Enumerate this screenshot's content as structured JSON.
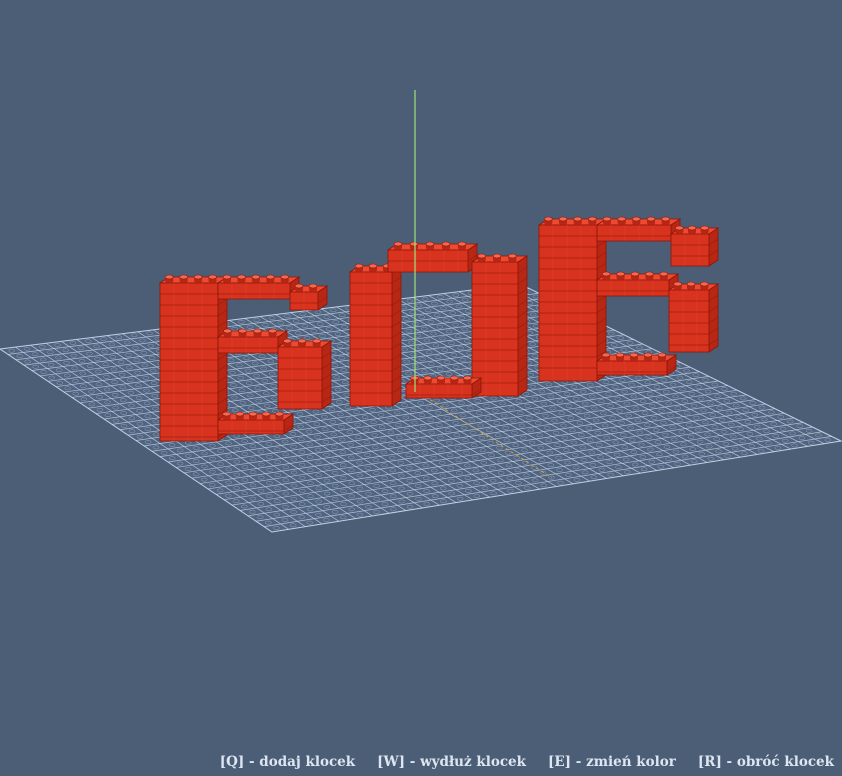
{
  "colors": {
    "background": "#4b5e76",
    "grid_line": "#c4d2e2",
    "brick_front": "#d8331f",
    "brick_side": "#b82614",
    "brick_top": "#ec4a33",
    "brick_edge": "#8e1608",
    "stud": "#e8422c",
    "stud_top": "#f36a52",
    "axis_vertical": "#9ee27a",
    "axis_depth": "#d9a040",
    "hud_text": "#dde6f2"
  },
  "hud": {
    "hints": [
      {
        "key": "[Q]",
        "label": "dodaj klocek"
      },
      {
        "key": "[W]",
        "label": "wydłuż klocek"
      },
      {
        "key": "[E]",
        "label": "zmień kolor"
      },
      {
        "key": "[R]",
        "label": "obróć klocek"
      }
    ],
    "hint_texts": [
      "[Q] - dodaj klocek",
      "[W] - wydłuż klocek",
      "[E] - zmień kolor",
      "[R] - obróć klocek"
    ]
  },
  "scene": {
    "objects": [
      "baseplate-grid",
      "vertical-axis",
      "depth-axis",
      "letter-b-left",
      "letter-pi",
      "letter-b-right"
    ]
  }
}
